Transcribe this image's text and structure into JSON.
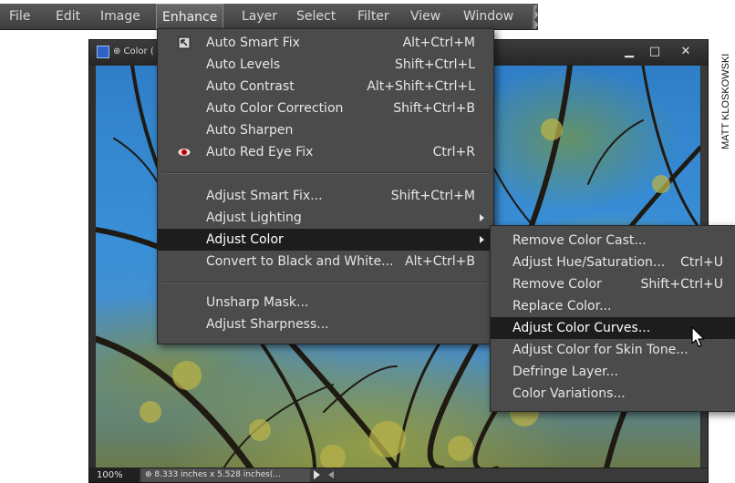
{
  "menubar": {
    "items": [
      "File",
      "Edit",
      "Image",
      "Enhance",
      "Layer",
      "Select",
      "Filter",
      "View",
      "Window"
    ],
    "active": "Enhance"
  },
  "document": {
    "title": "⊕ Color (",
    "zoom": "100%",
    "info": "⊕ 8.333 inches x 5.528 inches(..."
  },
  "enhance_menu": {
    "auto_smart_fix": {
      "label": "Auto Smart Fix",
      "shortcut": "Alt+Ctrl+M"
    },
    "auto_levels": {
      "label": "Auto Levels",
      "shortcut": "Shift+Ctrl+L"
    },
    "auto_contrast": {
      "label": "Auto Contrast",
      "shortcut": "Alt+Shift+Ctrl+L"
    },
    "auto_color_correction": {
      "label": "Auto Color Correction",
      "shortcut": "Shift+Ctrl+B"
    },
    "auto_sharpen": {
      "label": "Auto Sharpen",
      "shortcut": ""
    },
    "auto_red_eye_fix": {
      "label": "Auto Red Eye Fix",
      "shortcut": "Ctrl+R"
    },
    "adjust_smart_fix": {
      "label": "Adjust Smart Fix...",
      "shortcut": "Shift+Ctrl+M"
    },
    "adjust_lighting": {
      "label": "Adjust Lighting",
      "shortcut": ""
    },
    "adjust_color": {
      "label": "Adjust Color",
      "shortcut": ""
    },
    "convert_bw": {
      "label": "Convert to Black and White...",
      "shortcut": "Alt+Ctrl+B"
    },
    "unsharp_mask": {
      "label": "Unsharp Mask...",
      "shortcut": ""
    },
    "adjust_sharpness": {
      "label": "Adjust Sharpness...",
      "shortcut": ""
    }
  },
  "adjust_color_submenu": {
    "remove_color_cast": {
      "label": "Remove Color Cast...",
      "shortcut": ""
    },
    "adjust_hue_saturation": {
      "label": "Adjust Hue/Saturation...",
      "shortcut": "Ctrl+U"
    },
    "remove_color": {
      "label": "Remove Color",
      "shortcut": "Shift+Ctrl+U"
    },
    "replace_color": {
      "label": "Replace Color...",
      "shortcut": ""
    },
    "adjust_color_curves": {
      "label": "Adjust Color Curves...",
      "shortcut": ""
    },
    "adjust_skin_tone": {
      "label": "Adjust Color for Skin Tone...",
      "shortcut": ""
    },
    "defringe_layer": {
      "label": "Defringe Layer...",
      "shortcut": ""
    },
    "color_variations": {
      "label": "Color Variations...",
      "shortcut": ""
    }
  },
  "credit": "MATT KLOSKOWSKI",
  "colors": {
    "menubar_bg": "#4a4a4a",
    "menu_bg": "#4b4b4b",
    "highlight": "#1d1d1d",
    "text": "#e6e6e6"
  },
  "icons": [
    "smart-fix-icon",
    "red-eye-icon",
    "submenu-arrow-icon",
    "mouse-pointer-icon"
  ]
}
